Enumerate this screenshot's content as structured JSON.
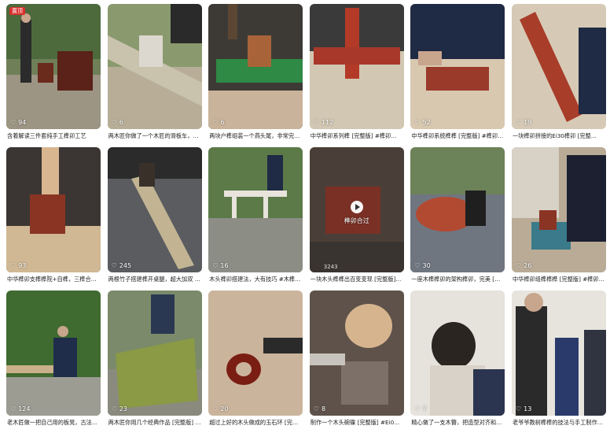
{
  "cards": [
    {
      "caption": "含着解读三件套纯手工榫卯工艺",
      "likes": "94",
      "badge": "置顶"
    },
    {
      "caption": "两木匠你做了一个木匠的滑板车，好…",
      "likes": "6"
    },
    {
      "caption": "两块户榫组装一个燕头尾，非常完比…",
      "likes": "6"
    },
    {
      "caption": "中华榫卯系列榫 [完整版] #榫卯…",
      "likes": "112"
    },
    {
      "caption": "中华榫卯系统榫榫 [完整版] #榫卯…",
      "likes": "52"
    },
    {
      "caption": "一块榫卯拼接的Ei30榫卯 [完整…",
      "likes": "19"
    },
    {
      "caption": "中华榫卯支榫榫院+自榫，三榫合一…",
      "likes": "93"
    },
    {
      "caption": "两根竹子搭建榫开桌腿，超大加双 #…",
      "likes": "245"
    },
    {
      "caption": "木头榫卯搭建法，大有技巧 #木榫榫…",
      "likes": "16"
    },
    {
      "caption": "一块木头榫榫出百变变现 [完整版]…",
      "likes": "",
      "video_label": "榫卯合过",
      "views": "3243"
    },
    {
      "caption": "一座木榫榫卯的架构榫卯，完美 [完…",
      "likes": "30"
    },
    {
      "caption": "中华榫卯组榫榫榫 [完整版] #榫卯结构",
      "likes": "26"
    },
    {
      "caption": "老木匠做一把自己用的板凳，古法榫…",
      "likes": "124"
    },
    {
      "caption": "两木匠你用几个经典作品 [完整版] #…",
      "likes": "23"
    },
    {
      "caption": "超过上好的木头做成的玉石环 [完整…",
      "likes": "20"
    },
    {
      "caption": "制作一个木头碗碟 [完整版] #Ei0…",
      "likes": "8"
    },
    {
      "caption": "精心做了一支木簪，把造型对齐和打…",
      "likes": "7"
    },
    {
      "caption": "老爷爷教树榫榫的技法与手工制作，教子们…",
      "likes": "13"
    }
  ],
  "colors": {
    "badge": "#d9302c",
    "caption": "#222222"
  },
  "icons": {
    "like": "heart-icon",
    "play": "play-icon"
  }
}
